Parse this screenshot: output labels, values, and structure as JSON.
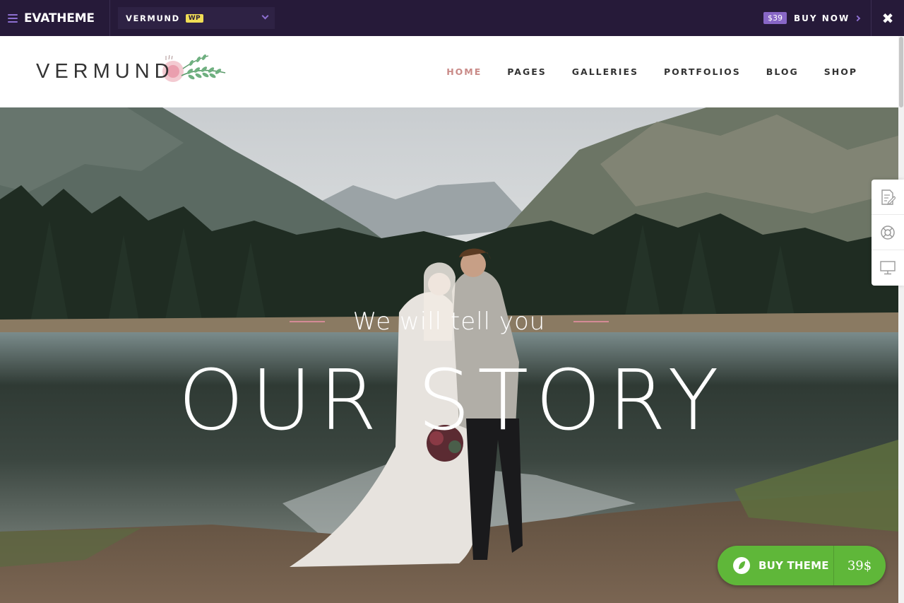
{
  "demo_bar": {
    "brand": "EVATHEME",
    "theme_name": "VERMUND",
    "theme_badge": "WP",
    "price": "$39",
    "buy_label": "BUY NOW",
    "close_symbol": "✖"
  },
  "header": {
    "logo_text": "VERMUND",
    "nav": [
      {
        "label": "HOME",
        "active": true
      },
      {
        "label": "PAGES",
        "active": false
      },
      {
        "label": "GALLERIES",
        "active": false
      },
      {
        "label": "PORTFOLIOS",
        "active": false
      },
      {
        "label": "BLOG",
        "active": false
      },
      {
        "label": "SHOP",
        "active": false
      }
    ]
  },
  "hero": {
    "subtitle": "We will tell you",
    "title": "OUR STORY"
  },
  "side_tools": [
    {
      "icon": "document-edit-icon"
    },
    {
      "icon": "lifebuoy-icon"
    },
    {
      "icon": "monitor-icon"
    }
  ],
  "buy_theme": {
    "label": "BUY THEME",
    "price": "39$",
    "icon": "leaf-icon"
  },
  "colors": {
    "demo_bar_bg": "#261a39",
    "accent_purple": "#8867c6",
    "nav_active": "#c98a87",
    "buy_theme_green": "#5fb739",
    "badge_yellow": "#f0dd55"
  }
}
